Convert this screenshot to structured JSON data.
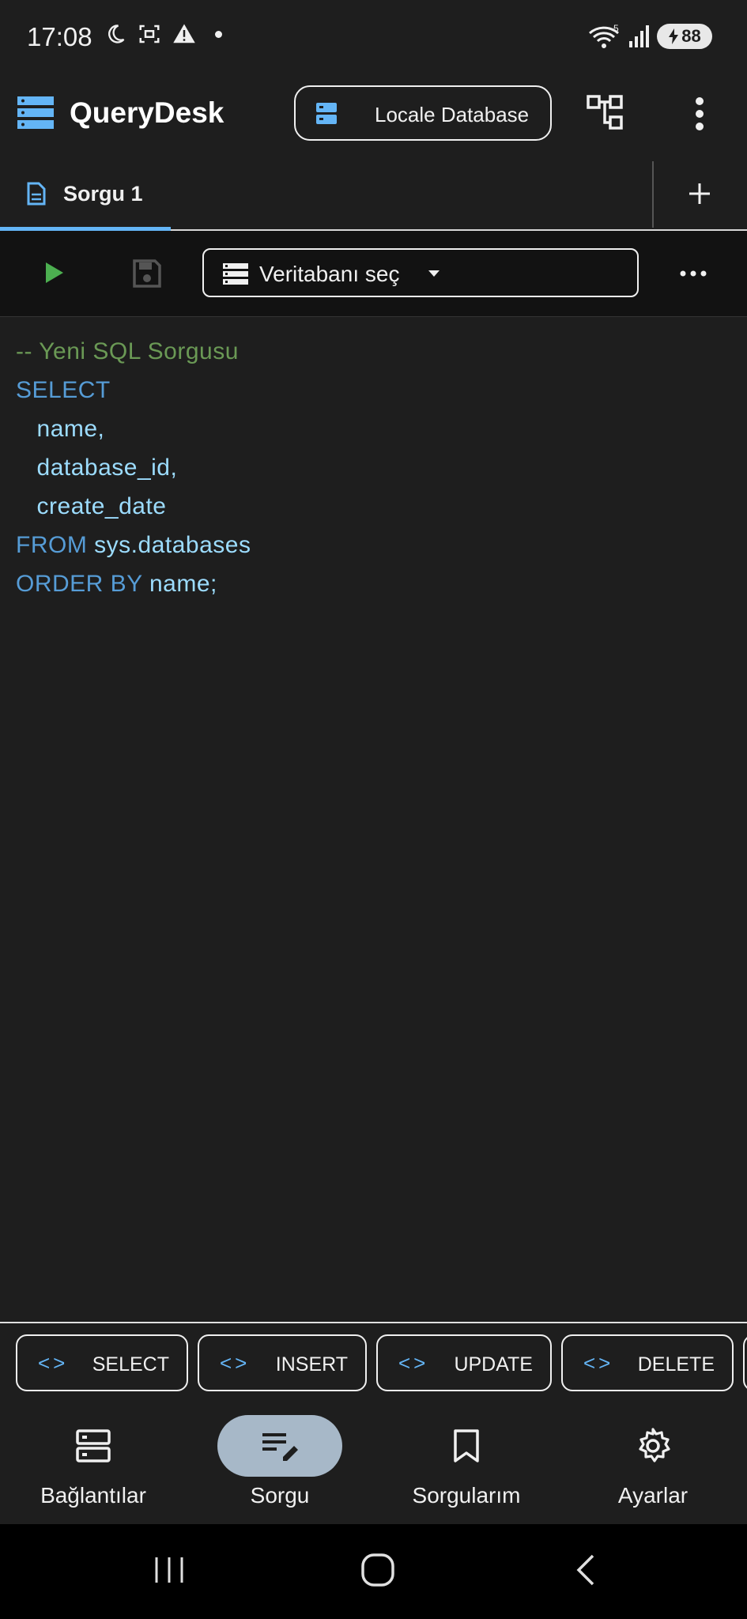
{
  "status_bar": {
    "time": "17:08",
    "battery": "88",
    "icons": [
      "moon-icon",
      "screenshot-icon",
      "warning-icon",
      "dot-icon",
      "wifi-icon",
      "signal-icon"
    ]
  },
  "app_bar": {
    "title": "QueryDesk",
    "connection_label": "Locale Database"
  },
  "tabs": {
    "items": [
      {
        "label": "Sorgu 1"
      }
    ]
  },
  "toolbar": {
    "database_select": "Veritabanı seç"
  },
  "editor": {
    "comment": "-- Yeni SQL Sorgusu",
    "select_kw": "SELECT",
    "col1": "name,",
    "col2": "database_id,",
    "col3": "create_date",
    "from_kw": "FROM",
    "from_table": "sys.databases",
    "order_kw": "ORDER BY",
    "order_col": "name;"
  },
  "snippets": [
    {
      "label": "SELECT"
    },
    {
      "label": "INSERT"
    },
    {
      "label": "UPDATE"
    },
    {
      "label": "DELETE"
    }
  ],
  "bottom_nav": [
    {
      "label": "Bağlantılar",
      "icon": "servers-icon"
    },
    {
      "label": "Sorgu",
      "icon": "edit-note-icon"
    },
    {
      "label": "Sorgularım",
      "icon": "bookmark-icon"
    },
    {
      "label": "Ayarlar",
      "icon": "gear-icon"
    }
  ],
  "colors": {
    "accent": "#64b5f6",
    "run": "#4caf50",
    "comment": "#6a9955",
    "keyword": "#569cd6",
    "identifier": "#9cdcfe",
    "active_nav": "#a7b8c8"
  }
}
